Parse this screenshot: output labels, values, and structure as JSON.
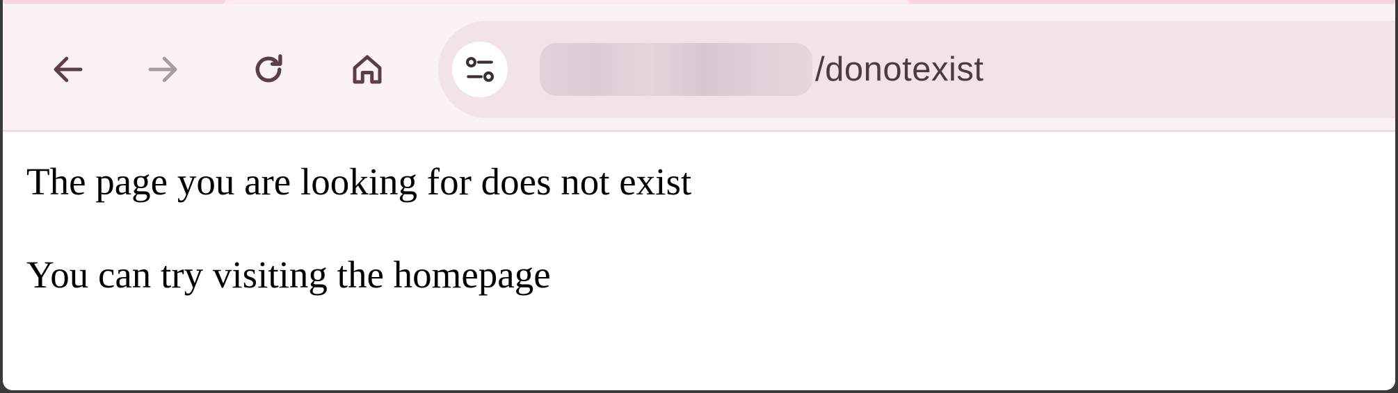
{
  "browser": {
    "toolbar": {
      "back_icon": "arrow-left-icon",
      "forward_icon": "arrow-right-icon",
      "reload_icon": "reload-icon",
      "home_icon": "home-icon",
      "forward_enabled": false
    },
    "omnibox": {
      "site_info_icon": "tune-icon",
      "host_redacted": true,
      "path": "/donotexist"
    },
    "colors": {
      "toolbar_bg": "#fcf1f3",
      "omnibox_bg": "#f2e3e8",
      "icon_color": "#5b3f47",
      "icon_disabled": "#a89ca0"
    }
  },
  "page": {
    "message": "The page you are looking for does not exist",
    "suggestion": "You can try visiting the homepage"
  }
}
